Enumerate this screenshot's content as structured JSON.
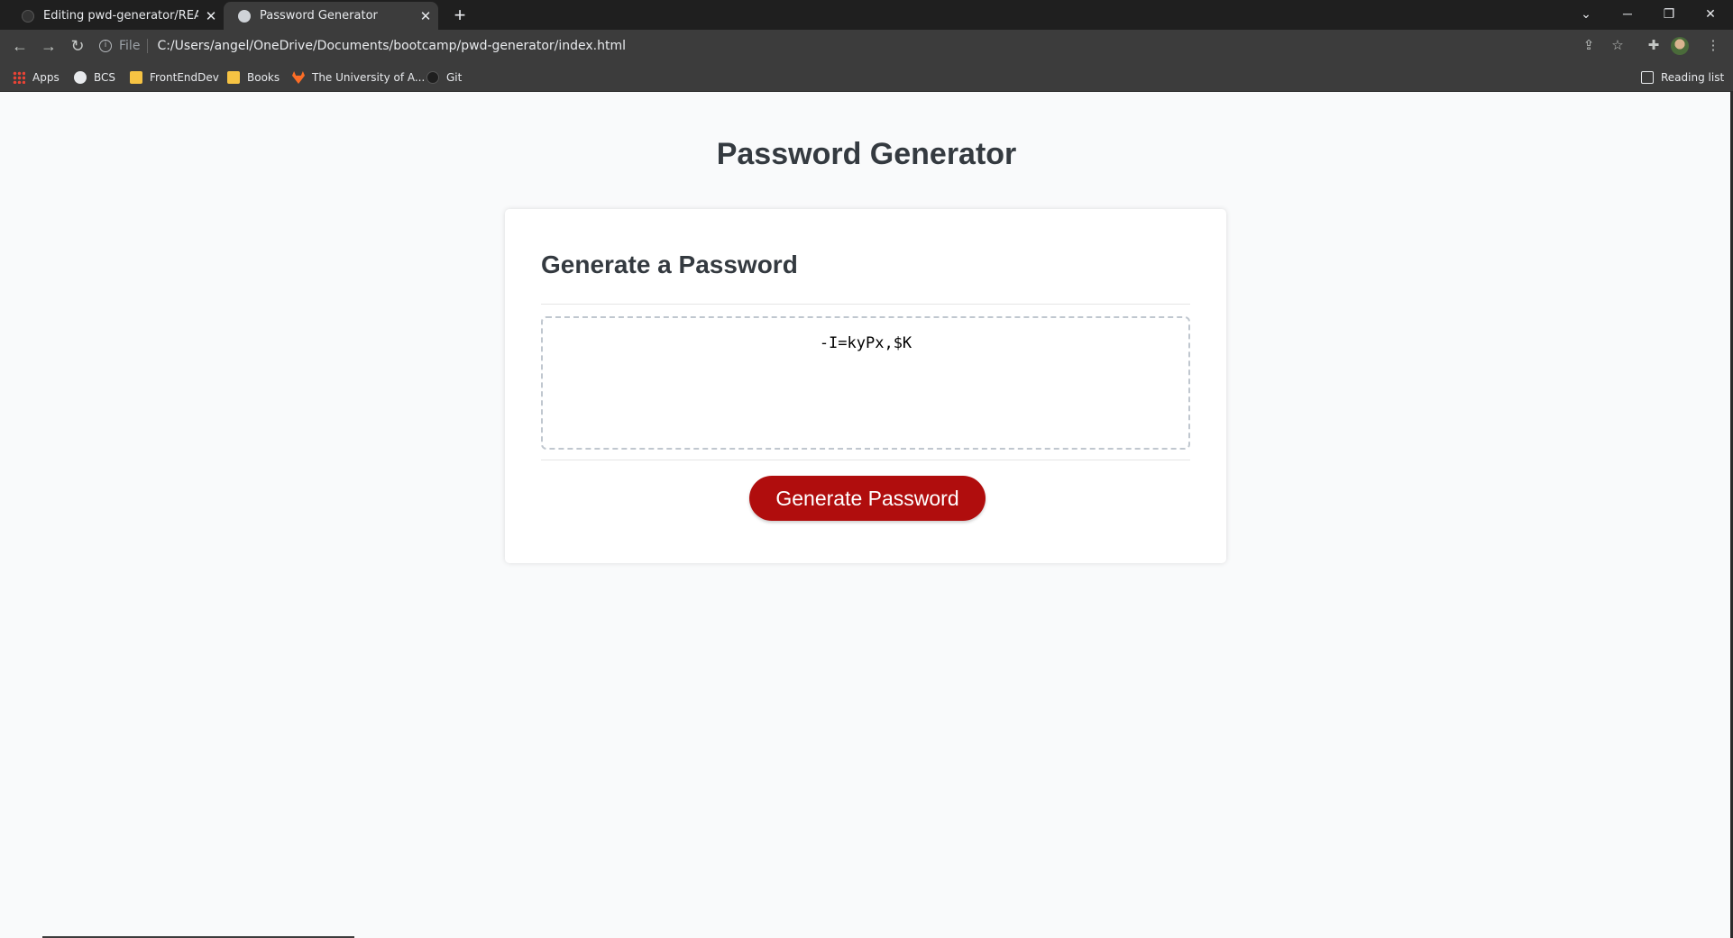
{
  "browser": {
    "tabs": [
      {
        "title": "Editing pwd-generator/README",
        "active": false
      },
      {
        "title": "Password Generator",
        "active": true
      }
    ],
    "new_tab_label": "+",
    "address": {
      "scheme": "File",
      "url": "C:/Users/angel/OneDrive/Documents/bootcamp/pwd-generator/index.html"
    },
    "bookmarks": [
      {
        "label": "Apps",
        "icon": "apps-grid-icon"
      },
      {
        "label": "BCS",
        "icon": "globe-icon"
      },
      {
        "label": "FrontEndDev",
        "icon": "folder-icon"
      },
      {
        "label": "Books",
        "icon": "folder-icon"
      },
      {
        "label": "The University of A...",
        "icon": "gitlab-icon"
      },
      {
        "label": "Git",
        "icon": "github-icon"
      }
    ],
    "reading_list_label": "Reading list"
  },
  "page": {
    "title": "Password Generator",
    "card_title": "Generate a Password",
    "password_value": "-I=kyPx,$K",
    "generate_button_label": "Generate Password"
  },
  "colors": {
    "button": "#b00d0d",
    "heading": "#343a40",
    "background": "#f9fafb"
  }
}
